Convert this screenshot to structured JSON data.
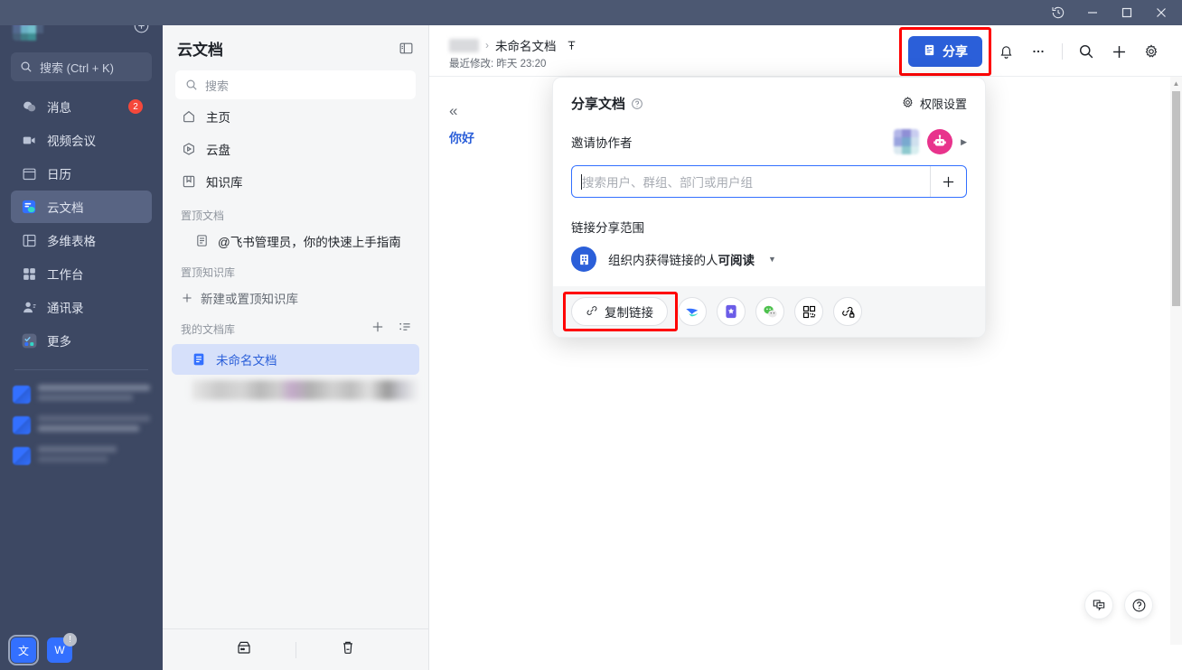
{
  "titlebar": {
    "buttons": [
      {
        "name": "history-icon",
        "label": "⭯"
      },
      {
        "name": "minimize-icon",
        "label": "—"
      },
      {
        "name": "maximize-icon",
        "label": "□"
      },
      {
        "name": "close-icon",
        "label": "✕"
      }
    ]
  },
  "rail": {
    "add_label": "+",
    "search": {
      "placeholder": "搜索 (Ctrl + K)"
    },
    "items": [
      {
        "label": "消息",
        "icon": "chat-icon",
        "badge": "2",
        "active": false
      },
      {
        "label": "视频会议",
        "icon": "video-icon",
        "badge": "",
        "active": false
      },
      {
        "label": "日历",
        "icon": "calendar-icon",
        "badge": "",
        "active": false
      },
      {
        "label": "云文档",
        "icon": "docs-icon",
        "badge": "",
        "active": true
      },
      {
        "label": "多维表格",
        "icon": "table-icon",
        "badge": "",
        "active": false
      },
      {
        "label": "工作台",
        "icon": "apps-icon",
        "badge": "",
        "active": false
      },
      {
        "label": "通讯录",
        "icon": "contacts-icon",
        "badge": "",
        "active": false
      },
      {
        "label": "更多",
        "icon": "more-apps-icon",
        "badge": "",
        "active": false
      }
    ],
    "taskbar": [
      {
        "name": "feishu-doc-task",
        "label": "文"
      },
      {
        "name": "wps-task",
        "label": "W",
        "dot": "!"
      }
    ]
  },
  "docsidebar": {
    "title": "云文档",
    "collapse_icon": "panel-collapse-icon",
    "search_placeholder": "搜索",
    "nav": [
      {
        "label": "主页",
        "icon": "home-icon"
      },
      {
        "label": "云盘",
        "icon": "drive-icon"
      },
      {
        "label": "知识库",
        "icon": "wiki-icon"
      }
    ],
    "pinned_docs_group": "置顶文档",
    "pinned_docs": [
      {
        "label": "@飞书管理员，你的快速上手指南",
        "icon": "doc-icon"
      }
    ],
    "pinned_wiki_group": "置顶知识库",
    "pinned_wiki_add": "新建或置顶知识库",
    "mylib_group": "我的文档库",
    "mylib_add_icon": "plus-icon",
    "mylib_sort_icon": "sort-icon",
    "mylib_docs": [
      {
        "label": "未命名文档",
        "icon": "doc-icon",
        "selected": true
      }
    ],
    "footer": [
      {
        "name": "storage-icon"
      },
      {
        "name": "trash-icon"
      }
    ]
  },
  "topbar": {
    "breadcrumb_sep": "›",
    "doc_title": "未命名文档",
    "pin_icon": "pin-icon",
    "modified": "最近修改: 昨天 23:20",
    "share_label": "分享",
    "share_icon": "share-doc-icon",
    "actions": [
      {
        "name": "notification-bell-icon",
        "glyph": "bell"
      },
      {
        "name": "more-options-icon",
        "glyph": "dots"
      },
      {
        "name": "search-icon",
        "glyph": "search"
      },
      {
        "name": "add-icon",
        "glyph": "plus"
      },
      {
        "name": "settings-gear-icon",
        "glyph": "gear"
      }
    ]
  },
  "document": {
    "collapse_chevron": "«",
    "body_text": "你好"
  },
  "share_popover": {
    "title": "分享文档",
    "help_icon": "question-circle-icon",
    "permission_settings": "权限设置",
    "permission_icon": "gear-icon",
    "invite_label": "邀请协作者",
    "invite_placeholder": "搜索用户、群组、部门或用户组",
    "invite_add_icon": "plus-icon",
    "avatars_expand_icon": "caret-right-icon",
    "scope_label": "链接分享范围",
    "scope_value_prefix": "组织内获得链接的人",
    "scope_value_bold": "可阅读",
    "scope_caret_icon": "caret-down-icon",
    "copy_link_label": "复制链接",
    "copy_link_icon": "link-icon",
    "share_targets": [
      {
        "name": "feishu-share-icon"
      },
      {
        "name": "doc-app-share-icon"
      },
      {
        "name": "wechat-share-icon"
      },
      {
        "name": "qrcode-share-icon"
      },
      {
        "name": "copy-secure-link-icon"
      }
    ]
  },
  "float_buttons": [
    {
      "name": "comment-panel-icon"
    },
    {
      "name": "help-icon"
    }
  ],
  "scrollbar": {
    "arrow_up": "▲"
  },
  "colors": {
    "rail_bg": "#3d4863",
    "titlebar_bg": "#4c5872",
    "accent": "#2b5fd9",
    "badge_red": "#f5483b",
    "highlight_red": "#ff0000",
    "selected_doc_bg": "#d6e0fa",
    "selected_doc_text": "#2b5fd9",
    "sidebar_bg": "#f5f6f7"
  }
}
